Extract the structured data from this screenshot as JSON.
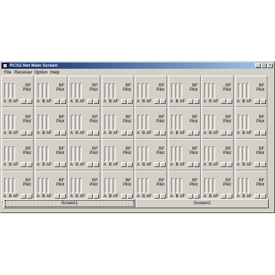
{
  "window": {
    "title": "RCS2.Net Main Screen",
    "minimize": "_",
    "maximize": "□",
    "close": "×"
  },
  "menu": [
    "File",
    "Receiver",
    "Option",
    "Help"
  ],
  "channel": {
    "rf": "RF",
    "pilot": "Pilot",
    "a": "A",
    "b": "B",
    "af": "AF"
  },
  "screens": [
    "Screen1",
    "Screen2"
  ],
  "colors": {
    "titlebar_start": "#0a246a",
    "titlebar_end": "#a6caf0",
    "face": "#d4d0c8"
  }
}
